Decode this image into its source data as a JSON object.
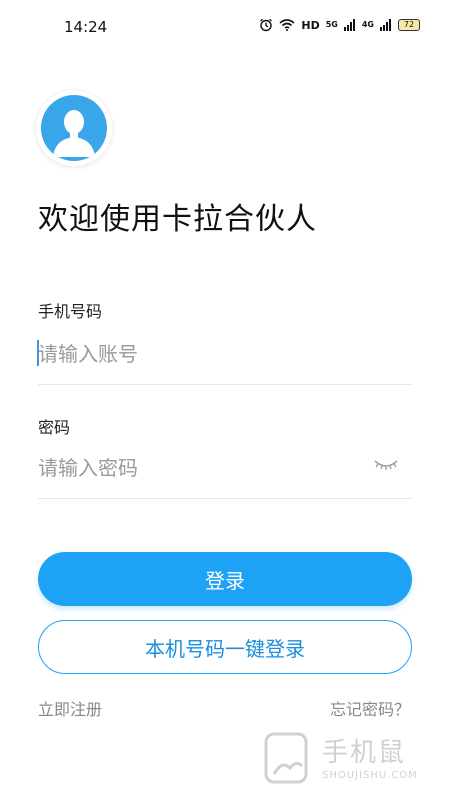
{
  "status_bar": {
    "time": "14:24",
    "hd_label": "HD",
    "net_5g": "5G",
    "net_4g": "4G",
    "battery": "72"
  },
  "header": {
    "title": "欢迎使用卡拉合伙人"
  },
  "form": {
    "phone_label": "手机号码",
    "phone_placeholder": "请输入账号",
    "password_label": "密码",
    "password_placeholder": "请输入密码"
  },
  "actions": {
    "login_label": "登录",
    "onekey_label": "本机号码一键登录",
    "register_label": "立即注册",
    "forgot_label": "忘记密码？"
  },
  "watermark": {
    "main": "手机鼠",
    "sub": "SHOUJISHU.COM"
  },
  "colors": {
    "primary": "#1ea2f5",
    "avatar_bg": "#3aa6ea",
    "muted_text": "#888888"
  },
  "icons": {
    "avatar": "person-silhouette-icon",
    "password_toggle": "eye-closed-icon",
    "alarm": "alarm-icon",
    "wifi": "wifi-icon",
    "signal": "signal-icon"
  }
}
